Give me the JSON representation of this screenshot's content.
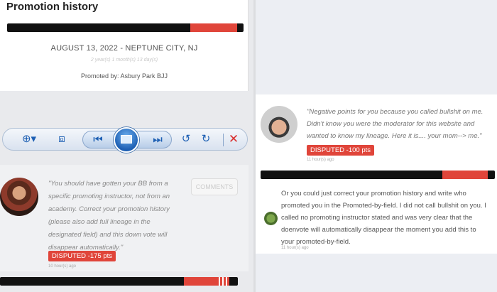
{
  "promotion": {
    "title": "Promotion history",
    "date_location": "AUGUST 13, 2022 - NEPTUNE CITY, NJ",
    "ago": "2 year(s) 1 month(s) 13 day(s)",
    "promoted_by": "Promoted by: Asbury Park BJJ"
  },
  "toolbar": {
    "zoom_icon": "zoom-in-icon",
    "fit_icon": "fit-to-screen-icon",
    "prev_icon": "skip-previous-icon",
    "slideshow_icon": "slideshow-icon",
    "next_icon": "skip-next-icon",
    "rotate_left_icon": "rotate-left-icon",
    "rotate_right_icon": "rotate-right-icon",
    "close_icon": "close-icon"
  },
  "left_comment": {
    "quote": "\"You should have gotten your BB from a specific promoting instructor, not from an academy. Correct your promotion history (please also add full lineage in the designated field) and this down vote will disappear automatically.\"",
    "comments_button": "COMMENTS",
    "badge": "DISPUTED -175 pts",
    "timestamp": "10 hour(s) ago"
  },
  "right_comment_1": {
    "quote": "\"Negative points for you because you called bullshit on me. Didn't know you were the moderator for this website and wanted to know my lineage. Here it is.... your mom--> me.\"",
    "badge": "DISPUTED -100 pts",
    "timestamp": "11 hour(s) ago"
  },
  "right_comment_2": {
    "text": "Or you could just correct your promotion history and write who promoted you in the Promoted-by-field. I did not call bullshit on you. I called no promoting instructor stated and was very clear that the doenvote will automatically disappear the moment you add this to your promoted-by-field.",
    "timestamp": "11 hour(s) ago"
  },
  "colors": {
    "belt_black": "#111111",
    "belt_bar_red": "#e0453a",
    "disputed_badge": "#e0453a",
    "toolbar_blue": "#1d5fb3"
  }
}
